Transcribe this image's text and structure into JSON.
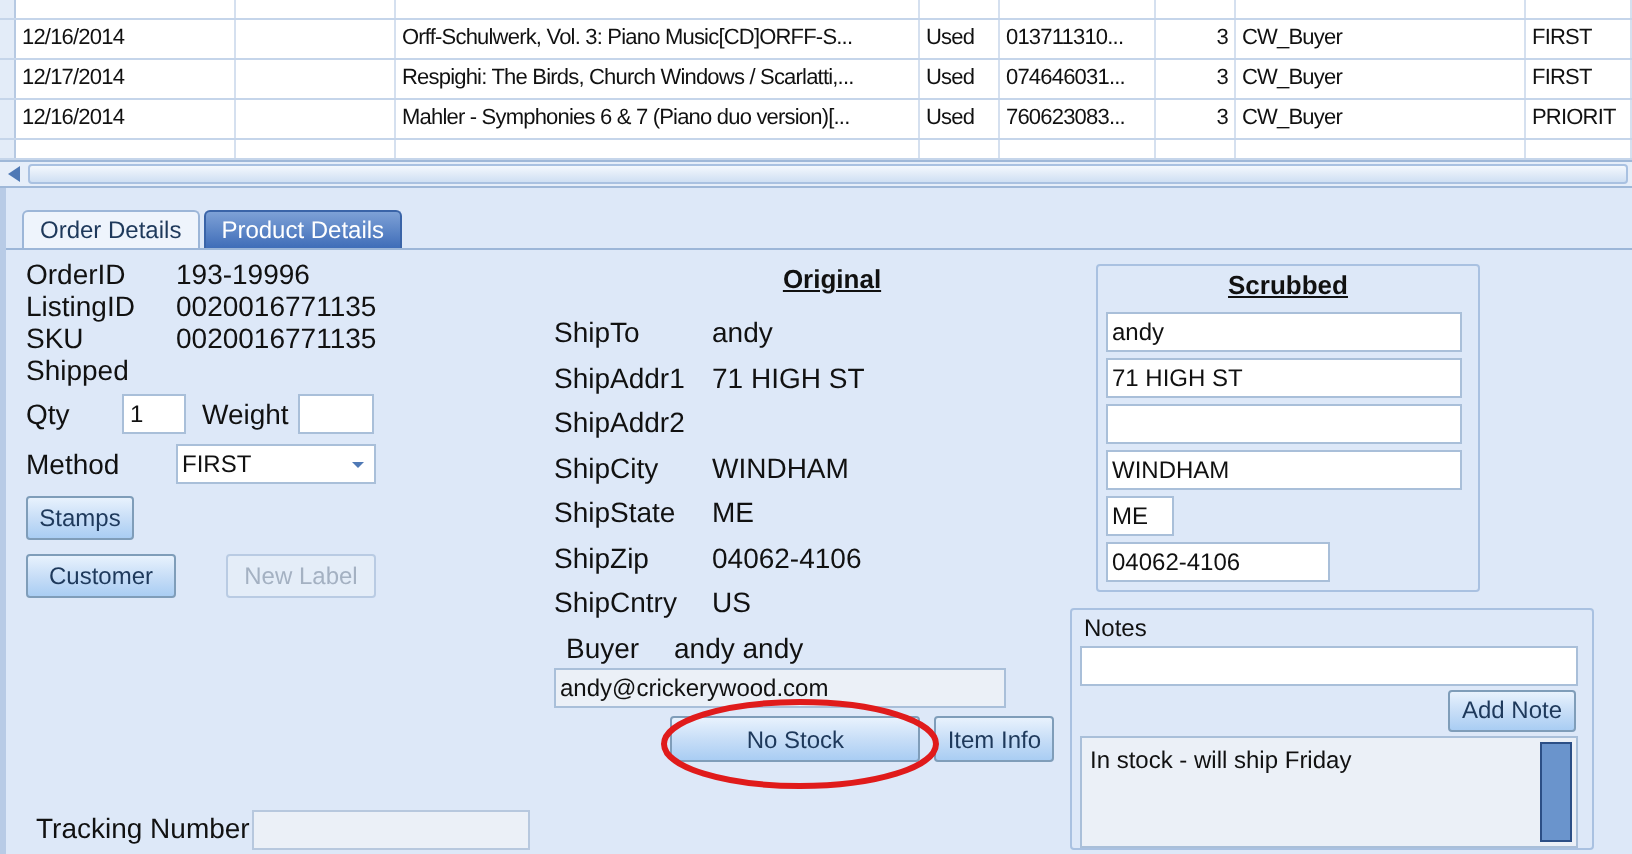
{
  "grid": {
    "rows": [
      {
        "column_1": "12/16/2014",
        "column_3": "Orff-Schulwerk, Vol. 3: Piano Music[CD]ORFF-S...",
        "column_4": "Used",
        "column_5": "013711310...",
        "column_6": "3",
        "column_7": "CW_Buyer",
        "column_8": "FIRST"
      },
      {
        "column_1": "12/17/2014",
        "column_3": "Respighi: The Birds, Church Windows / Scarlatti,...",
        "column_4": "Used",
        "column_5": "074646031...",
        "column_6": "3",
        "column_7": "CW_Buyer",
        "column_8": "FIRST"
      },
      {
        "column_1": "12/16/2014",
        "column_3": "Mahler - Symphonies 6 & 7 (Piano duo version)[...",
        "column_4": "Used",
        "column_5": "760623083...",
        "column_6": "3",
        "column_7": "CW_Buyer",
        "column_8": "PRIORIT"
      }
    ]
  },
  "tabs": [
    {
      "label": "Order Details",
      "selected": true
    },
    {
      "label": "Product Details",
      "selected": false
    }
  ],
  "order": {
    "info": [
      {
        "label": "OrderID",
        "value": "193-19996"
      },
      {
        "label": "ListingID",
        "value": "0020016771135"
      },
      {
        "label": "SKU",
        "value": "0020016771135"
      },
      {
        "label": "Shipped"
      }
    ],
    "qty_label": "Qty",
    "qty": "1",
    "weight_label": "Weight",
    "method_label": "Method",
    "method": "FIRST",
    "buttons": [
      {
        "label": "Stamps",
        "disabled": false
      },
      {
        "label": "Customer",
        "disabled": false
      },
      {
        "label": "New Label",
        "disabled": true
      }
    ],
    "tracking_label": "Tracking Number"
  },
  "original": {
    "title": "Original",
    "fields": [
      {
        "label": "ShipTo",
        "value": "andy"
      },
      {
        "label": "ShipAddr1",
        "value": "71 HIGH ST"
      },
      {
        "label": "ShipAddr2"
      },
      {
        "label": "ShipCity",
        "value": "WINDHAM"
      },
      {
        "label": "ShipState",
        "value": "ME"
      },
      {
        "label": "ShipZip",
        "value": "04062-4106"
      },
      {
        "label": "ShipCntry",
        "value": "US"
      }
    ],
    "buyer_label": "Buyer",
    "buyer": "andy andy",
    "email": "andy@crickerywood.com",
    "buttons": [
      "No Stock",
      "Item Info"
    ]
  },
  "scrubbed": {
    "title": "Scrubbed",
    "fields": [
      {
        "value": "andy",
        "kind": "wide"
      },
      {
        "value": "71 HIGH ST",
        "kind": "wide"
      },
      {
        "kind": "wide"
      },
      {
        "value": "WINDHAM",
        "kind": "wide"
      },
      {
        "value": "ME",
        "kind": "small"
      },
      {
        "value": "04062-4106",
        "kind": "medium"
      }
    ]
  },
  "notes": {
    "title": "Notes",
    "button": "Add Note",
    "log": "In stock - will ship Friday"
  }
}
